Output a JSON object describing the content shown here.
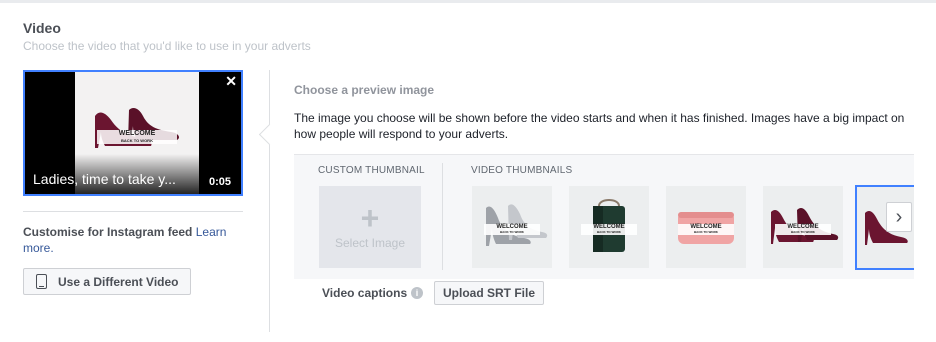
{
  "section": {
    "title": "Video",
    "subtitle": "Choose the video that you'd like to use in your adverts"
  },
  "video": {
    "title": "Ladies, time to take y...",
    "duration": "0:05",
    "close_glyph": "✕",
    "overlay_line1": "WELCOME",
    "overlay_line2": "BACK TO WORK"
  },
  "instagram": {
    "label": "Customise for Instagram feed",
    "link": "Learn more."
  },
  "buttons": {
    "use_different_video": "Use a Different Video",
    "upload_srt": "Upload SRT File"
  },
  "preview": {
    "title": "Choose a preview image",
    "description": "The image you choose will be shown before the video starts and when it has finished. Images have a big impact on how people will respond to your adverts.",
    "custom_thumbnail_label": "CUSTOM THUMBNAIL",
    "select_image_label": "Select Image",
    "plus_glyph": "+",
    "video_thumbnails_label": "VIDEO THUMBNAILS",
    "next_glyph": "›",
    "thumbnails": [
      {
        "subject": "silver-heels",
        "line1": "WELCOME",
        "line2": "BACK TO WORK",
        "selected": false
      },
      {
        "subject": "green-bag",
        "line1": "WELCOME",
        "line2": "BACK TO WORK",
        "selected": false
      },
      {
        "subject": "pink-case",
        "line1": "WELCOME",
        "line2": "BACK TO WORK",
        "selected": false
      },
      {
        "subject": "burgundy-heels",
        "line1": "WELCOME",
        "line2": "BACK TO WORK",
        "selected": false
      },
      {
        "subject": "burgundy-heels",
        "line1": "",
        "line2": "",
        "selected": true
      }
    ]
  },
  "captions": {
    "label": "Video captions",
    "info_glyph": "i"
  },
  "colors": {
    "accent": "#4080ff",
    "link": "#365899",
    "shoe": "#6b1530",
    "bag": "#1f3b30",
    "case": "#f0a4a4"
  }
}
